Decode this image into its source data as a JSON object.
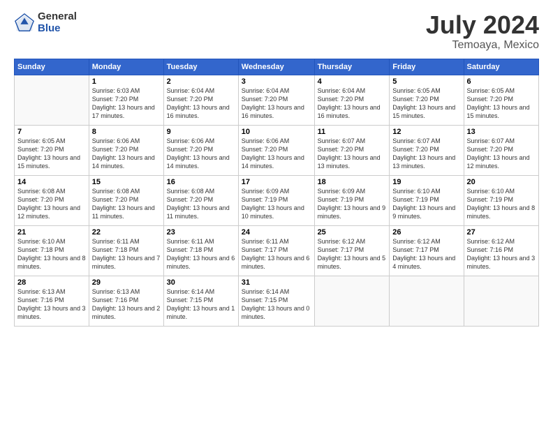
{
  "logo": {
    "general": "General",
    "blue": "Blue"
  },
  "title": "July 2024",
  "subtitle": "Temoaya, Mexico",
  "days_header": [
    "Sunday",
    "Monday",
    "Tuesday",
    "Wednesday",
    "Thursday",
    "Friday",
    "Saturday"
  ],
  "weeks": [
    [
      {
        "day": "",
        "sunrise": "",
        "sunset": "",
        "daylight": ""
      },
      {
        "day": "1",
        "sunrise": "Sunrise: 6:03 AM",
        "sunset": "Sunset: 7:20 PM",
        "daylight": "Daylight: 13 hours and 17 minutes."
      },
      {
        "day": "2",
        "sunrise": "Sunrise: 6:04 AM",
        "sunset": "Sunset: 7:20 PM",
        "daylight": "Daylight: 13 hours and 16 minutes."
      },
      {
        "day": "3",
        "sunrise": "Sunrise: 6:04 AM",
        "sunset": "Sunset: 7:20 PM",
        "daylight": "Daylight: 13 hours and 16 minutes."
      },
      {
        "day": "4",
        "sunrise": "Sunrise: 6:04 AM",
        "sunset": "Sunset: 7:20 PM",
        "daylight": "Daylight: 13 hours and 16 minutes."
      },
      {
        "day": "5",
        "sunrise": "Sunrise: 6:05 AM",
        "sunset": "Sunset: 7:20 PM",
        "daylight": "Daylight: 13 hours and 15 minutes."
      },
      {
        "day": "6",
        "sunrise": "Sunrise: 6:05 AM",
        "sunset": "Sunset: 7:20 PM",
        "daylight": "Daylight: 13 hours and 15 minutes."
      }
    ],
    [
      {
        "day": "7",
        "sunrise": "Sunrise: 6:05 AM",
        "sunset": "Sunset: 7:20 PM",
        "daylight": "Daylight: 13 hours and 15 minutes."
      },
      {
        "day": "8",
        "sunrise": "Sunrise: 6:06 AM",
        "sunset": "Sunset: 7:20 PM",
        "daylight": "Daylight: 13 hours and 14 minutes."
      },
      {
        "day": "9",
        "sunrise": "Sunrise: 6:06 AM",
        "sunset": "Sunset: 7:20 PM",
        "daylight": "Daylight: 13 hours and 14 minutes."
      },
      {
        "day": "10",
        "sunrise": "Sunrise: 6:06 AM",
        "sunset": "Sunset: 7:20 PM",
        "daylight": "Daylight: 13 hours and 14 minutes."
      },
      {
        "day": "11",
        "sunrise": "Sunrise: 6:07 AM",
        "sunset": "Sunset: 7:20 PM",
        "daylight": "Daylight: 13 hours and 13 minutes."
      },
      {
        "day": "12",
        "sunrise": "Sunrise: 6:07 AM",
        "sunset": "Sunset: 7:20 PM",
        "daylight": "Daylight: 13 hours and 13 minutes."
      },
      {
        "day": "13",
        "sunrise": "Sunrise: 6:07 AM",
        "sunset": "Sunset: 7:20 PM",
        "daylight": "Daylight: 13 hours and 12 minutes."
      }
    ],
    [
      {
        "day": "14",
        "sunrise": "Sunrise: 6:08 AM",
        "sunset": "Sunset: 7:20 PM",
        "daylight": "Daylight: 13 hours and 12 minutes."
      },
      {
        "day": "15",
        "sunrise": "Sunrise: 6:08 AM",
        "sunset": "Sunset: 7:20 PM",
        "daylight": "Daylight: 13 hours and 11 minutes."
      },
      {
        "day": "16",
        "sunrise": "Sunrise: 6:08 AM",
        "sunset": "Sunset: 7:20 PM",
        "daylight": "Daylight: 13 hours and 11 minutes."
      },
      {
        "day": "17",
        "sunrise": "Sunrise: 6:09 AM",
        "sunset": "Sunset: 7:19 PM",
        "daylight": "Daylight: 13 hours and 10 minutes."
      },
      {
        "day": "18",
        "sunrise": "Sunrise: 6:09 AM",
        "sunset": "Sunset: 7:19 PM",
        "daylight": "Daylight: 13 hours and 9 minutes."
      },
      {
        "day": "19",
        "sunrise": "Sunrise: 6:10 AM",
        "sunset": "Sunset: 7:19 PM",
        "daylight": "Daylight: 13 hours and 9 minutes."
      },
      {
        "day": "20",
        "sunrise": "Sunrise: 6:10 AM",
        "sunset": "Sunset: 7:19 PM",
        "daylight": "Daylight: 13 hours and 8 minutes."
      }
    ],
    [
      {
        "day": "21",
        "sunrise": "Sunrise: 6:10 AM",
        "sunset": "Sunset: 7:18 PM",
        "daylight": "Daylight: 13 hours and 8 minutes."
      },
      {
        "day": "22",
        "sunrise": "Sunrise: 6:11 AM",
        "sunset": "Sunset: 7:18 PM",
        "daylight": "Daylight: 13 hours and 7 minutes."
      },
      {
        "day": "23",
        "sunrise": "Sunrise: 6:11 AM",
        "sunset": "Sunset: 7:18 PM",
        "daylight": "Daylight: 13 hours and 6 minutes."
      },
      {
        "day": "24",
        "sunrise": "Sunrise: 6:11 AM",
        "sunset": "Sunset: 7:17 PM",
        "daylight": "Daylight: 13 hours and 6 minutes."
      },
      {
        "day": "25",
        "sunrise": "Sunrise: 6:12 AM",
        "sunset": "Sunset: 7:17 PM",
        "daylight": "Daylight: 13 hours and 5 minutes."
      },
      {
        "day": "26",
        "sunrise": "Sunrise: 6:12 AM",
        "sunset": "Sunset: 7:17 PM",
        "daylight": "Daylight: 13 hours and 4 minutes."
      },
      {
        "day": "27",
        "sunrise": "Sunrise: 6:12 AM",
        "sunset": "Sunset: 7:16 PM",
        "daylight": "Daylight: 13 hours and 3 minutes."
      }
    ],
    [
      {
        "day": "28",
        "sunrise": "Sunrise: 6:13 AM",
        "sunset": "Sunset: 7:16 PM",
        "daylight": "Daylight: 13 hours and 3 minutes."
      },
      {
        "day": "29",
        "sunrise": "Sunrise: 6:13 AM",
        "sunset": "Sunset: 7:16 PM",
        "daylight": "Daylight: 13 hours and 2 minutes."
      },
      {
        "day": "30",
        "sunrise": "Sunrise: 6:14 AM",
        "sunset": "Sunset: 7:15 PM",
        "daylight": "Daylight: 13 hours and 1 minute."
      },
      {
        "day": "31",
        "sunrise": "Sunrise: 6:14 AM",
        "sunset": "Sunset: 7:15 PM",
        "daylight": "Daylight: 13 hours and 0 minutes."
      },
      {
        "day": "",
        "sunrise": "",
        "sunset": "",
        "daylight": ""
      },
      {
        "day": "",
        "sunrise": "",
        "sunset": "",
        "daylight": ""
      },
      {
        "day": "",
        "sunrise": "",
        "sunset": "",
        "daylight": ""
      }
    ]
  ]
}
